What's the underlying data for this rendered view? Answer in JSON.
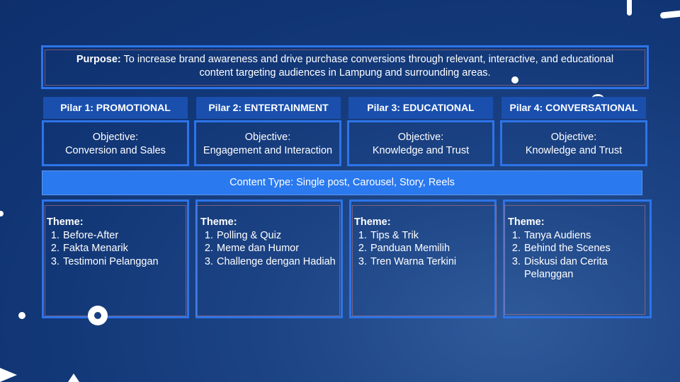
{
  "purpose": {
    "label": "Purpose:",
    "text": "To increase brand awareness and drive purchase conversions through relevant, interactive, and educational content targeting audiences in Lampung and surrounding areas."
  },
  "pillars": [
    {
      "title": "Pilar 1: PROMOTIONAL",
      "objective_label": "Objective:",
      "objective": "Conversion and Sales",
      "theme_label": "Theme:",
      "themes": [
        "Before-After",
        "Fakta Menarik",
        "Testimoni Pelanggan"
      ]
    },
    {
      "title": "Pilar 2:  ENTERTAINMENT",
      "objective_label": "Objective:",
      "objective": "Engagement and Interaction",
      "theme_label": "Theme:",
      "themes": [
        "Polling & Quiz",
        "Meme dan Humor",
        "Challenge dengan Hadiah"
      ]
    },
    {
      "title": "Pilar 3: EDUCATIONAL",
      "objective_label": "Objective:",
      "objective": "Knowledge and Trust",
      "theme_label": "Theme:",
      "themes": [
        "Tips & Trik",
        "Panduan Memilih",
        "Tren Warna Terkini"
      ]
    },
    {
      "title": "Pilar 4: CONVERSATIONAL",
      "objective_label": "Objective:",
      "objective": "Knowledge and Trust",
      "theme_label": "Theme:",
      "themes": [
        "Tanya Audiens",
        "Behind the Scenes",
        "Diskusi dan Cerita Pelanggan"
      ]
    }
  ],
  "content_type": "Content Type: Single post, Carousel, Story, Reels",
  "colors": {
    "background": "#123777",
    "frame_border": "#2d74e8",
    "header_fill": "#1a4fae",
    "content_bar": "#2a79ee"
  }
}
